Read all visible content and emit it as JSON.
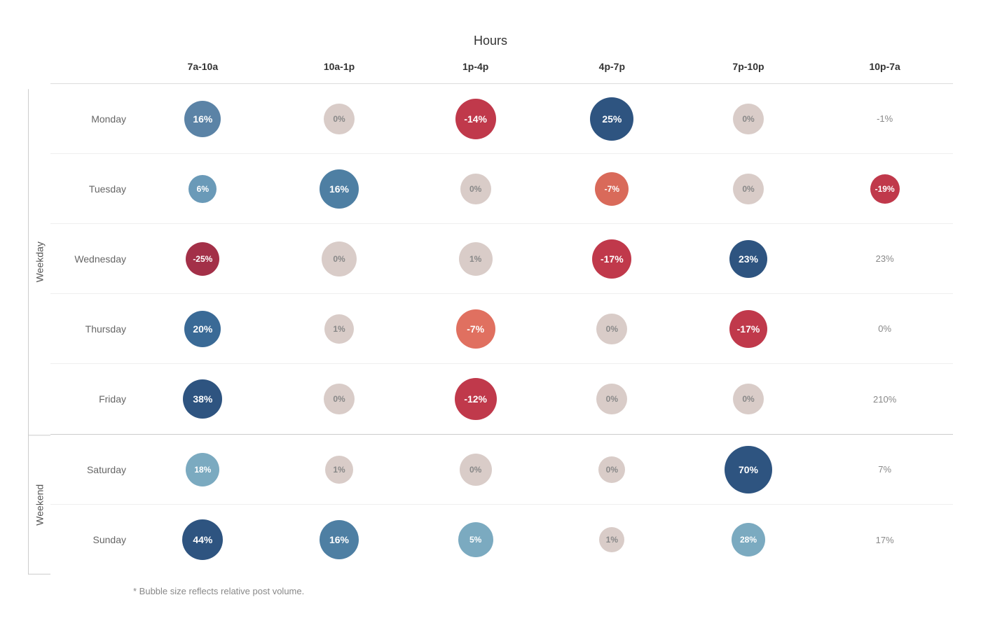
{
  "title": "Hours",
  "columns": [
    "7a-10a",
    "10a-1p",
    "1p-4p",
    "4p-7p",
    "7p-10p",
    "10p-7a"
  ],
  "weekday_label": "Weekday",
  "weekend_label": "Weekend",
  "footnote": "* Bubble size reflects relative post volume.",
  "rows": [
    {
      "day": "Monday",
      "group": "weekday",
      "cells": [
        {
          "value": "16%",
          "size": 52,
          "color": "#5b83a6",
          "text_color": "#fff"
        },
        {
          "value": "0%",
          "size": 44,
          "color": "#d9ccc8",
          "text_color": "#888"
        },
        {
          "value": "-14%",
          "size": 58,
          "color": "#c0394b",
          "text_color": "#fff"
        },
        {
          "value": "25%",
          "size": 62,
          "color": "#2e5480",
          "text_color": "#fff"
        },
        {
          "value": "0%",
          "size": 44,
          "color": "#d9ccc8",
          "text_color": "#888"
        },
        {
          "value": "-1%",
          "size": 28,
          "color": "#fff",
          "text_color": "#888",
          "no_bubble": true
        }
      ]
    },
    {
      "day": "Tuesday",
      "group": "weekday",
      "cells": [
        {
          "value": "6%",
          "size": 40,
          "color": "#6a9ab8",
          "text_color": "#fff"
        },
        {
          "value": "16%",
          "size": 56,
          "color": "#4e7fa3",
          "text_color": "#fff"
        },
        {
          "value": "0%",
          "size": 44,
          "color": "#d9ccc8",
          "text_color": "#888"
        },
        {
          "value": "-7%",
          "size": 48,
          "color": "#d96a5a",
          "text_color": "#fff"
        },
        {
          "value": "0%",
          "size": 44,
          "color": "#d9ccc8",
          "text_color": "#888"
        },
        {
          "value": "-19%",
          "size": 42,
          "color": "#c0394b",
          "text_color": "#fff"
        }
      ]
    },
    {
      "day": "Wednesday",
      "group": "weekday",
      "cells": [
        {
          "value": "-25%",
          "size": 48,
          "color": "#a33048",
          "text_color": "#fff"
        },
        {
          "value": "0%",
          "size": 50,
          "color": "#d9ccc8",
          "text_color": "#888"
        },
        {
          "value": "1%",
          "size": 48,
          "color": "#d9ccc8",
          "text_color": "#888"
        },
        {
          "value": "-17%",
          "size": 56,
          "color": "#c0394b",
          "text_color": "#fff"
        },
        {
          "value": "23%",
          "size": 54,
          "color": "#2e5480",
          "text_color": "#fff"
        },
        {
          "value": "23%",
          "size": 38,
          "color": "#fff",
          "text_color": "#888",
          "no_bubble": true
        }
      ]
    },
    {
      "day": "Thursday",
      "group": "weekday",
      "cells": [
        {
          "value": "20%",
          "size": 52,
          "color": "#3a6a96",
          "text_color": "#fff"
        },
        {
          "value": "1%",
          "size": 42,
          "color": "#d9ccc8",
          "text_color": "#888"
        },
        {
          "value": "-7%",
          "size": 56,
          "color": "#e07060",
          "text_color": "#fff"
        },
        {
          "value": "0%",
          "size": 44,
          "color": "#d9ccc8",
          "text_color": "#888"
        },
        {
          "value": "-17%",
          "size": 54,
          "color": "#c0394b",
          "text_color": "#fff"
        },
        {
          "value": "0%",
          "size": 28,
          "color": "#fff",
          "text_color": "#888",
          "no_bubble": true
        }
      ]
    },
    {
      "day": "Friday",
      "group": "weekday",
      "cells": [
        {
          "value": "38%",
          "size": 56,
          "color": "#2e5480",
          "text_color": "#fff"
        },
        {
          "value": "0%",
          "size": 44,
          "color": "#d9ccc8",
          "text_color": "#888"
        },
        {
          "value": "-12%",
          "size": 60,
          "color": "#c0394b",
          "text_color": "#fff"
        },
        {
          "value": "0%",
          "size": 44,
          "color": "#d9ccc8",
          "text_color": "#888"
        },
        {
          "value": "0%",
          "size": 44,
          "color": "#d9ccc8",
          "text_color": "#888"
        },
        {
          "value": "210%",
          "size": 28,
          "color": "#fff",
          "text_color": "#888",
          "no_bubble": true
        }
      ]
    },
    {
      "day": "Saturday",
      "group": "weekend",
      "cells": [
        {
          "value": "18%",
          "size": 48,
          "color": "#7baac0",
          "text_color": "#fff"
        },
        {
          "value": "1%",
          "size": 40,
          "color": "#d9ccc8",
          "text_color": "#888"
        },
        {
          "value": "0%",
          "size": 46,
          "color": "#d9ccc8",
          "text_color": "#888"
        },
        {
          "value": "0%",
          "size": 38,
          "color": "#d9ccc8",
          "text_color": "#888"
        },
        {
          "value": "70%",
          "size": 68,
          "color": "#2e5480",
          "text_color": "#fff"
        },
        {
          "value": "7%",
          "size": 30,
          "color": "#fff",
          "text_color": "#888",
          "no_bubble": true
        }
      ]
    },
    {
      "day": "Sunday",
      "group": "weekend",
      "cells": [
        {
          "value": "44%",
          "size": 58,
          "color": "#2e5480",
          "text_color": "#fff"
        },
        {
          "value": "16%",
          "size": 56,
          "color": "#4e7fa3",
          "text_color": "#fff"
        },
        {
          "value": "5%",
          "size": 50,
          "color": "#7baac0",
          "text_color": "#fff"
        },
        {
          "value": "1%",
          "size": 36,
          "color": "#d9ccc8",
          "text_color": "#888"
        },
        {
          "value": "28%",
          "size": 48,
          "color": "#7baac0",
          "text_color": "#fff"
        },
        {
          "value": "17%",
          "size": 32,
          "color": "#fff",
          "text_color": "#888",
          "no_bubble": true
        }
      ]
    }
  ]
}
